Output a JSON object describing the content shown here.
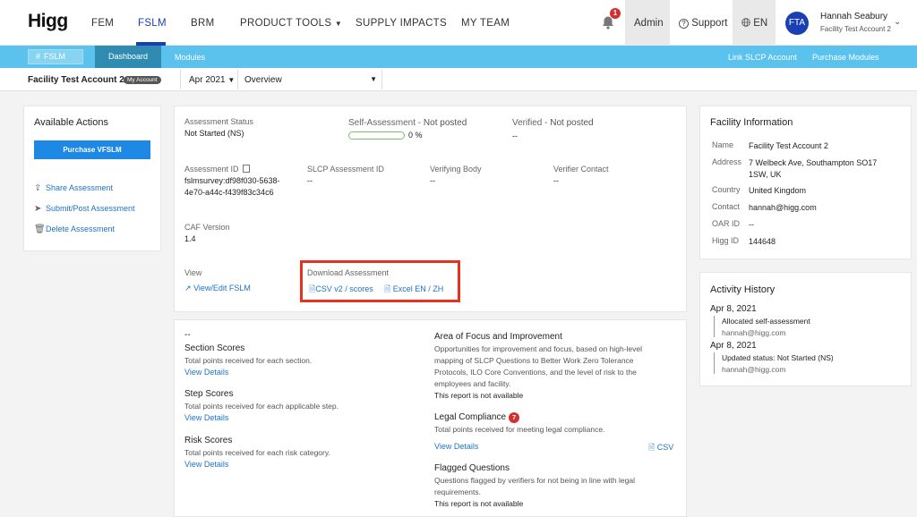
{
  "brand": {
    "logo": "Higg",
    "accent": "#1a3fb5",
    "subnav_color": "#5bc2ee"
  },
  "nav": {
    "items": [
      "FEM",
      "FSLM",
      "BRM",
      "PRODUCT TOOLS",
      "SUPPLY IMPACTS",
      "MY TEAM"
    ],
    "active": "FSLM",
    "notification_count": "1",
    "admin": "Admin",
    "support": "Support",
    "language": "EN"
  },
  "user": {
    "initials": "FTA",
    "name": "Hannah Seabury",
    "account": "Facility Test Account 2"
  },
  "subnav": {
    "pill": "FSLM",
    "tab": "Dashboard",
    "modules": "Modules",
    "link_slcp": "Link SLCP Account",
    "purchase_modules": "Purchase Modules"
  },
  "account_bar": {
    "name": "Facility Test Account 2",
    "badge": "My Account",
    "period": "Apr 2021",
    "view": "Overview"
  },
  "actions": {
    "title": "Available Actions",
    "purchase": "Purchase VFSLM",
    "items": [
      "Share Assessment",
      "Submit/Post Assessment",
      "Delete Assessment"
    ]
  },
  "assessment": {
    "status_label": "Assessment Status",
    "status_value": "Not Started (NS)",
    "self_label": "Self-Assessment - ",
    "self_value": "Not posted",
    "progress_percent": 0,
    "progress_text": "0 %",
    "verified_label": "Verified - ",
    "verified_value": "Not posted",
    "verified_sub": "--",
    "id_label": "Assessment ID",
    "id_value_line1": "fslmsurvey:df98f030-5638-",
    "id_value_line2": "4e70-a44c-f439f83c34c6",
    "slcp_label": "SLCP Assessment ID",
    "slcp_value": "--",
    "verifying_label": "Verifying Body",
    "verifying_value": "--",
    "verifier_label": "Verifier Contact",
    "verifier_value": "--",
    "caf_label": "CAF Version",
    "caf_value": "1.4",
    "view_label": "View",
    "view_link": "View/Edit FSLM",
    "download_label": "Download Assessment",
    "download_csv": "CSV v2 / scores",
    "download_excel": "Excel EN / ZH"
  },
  "scores": {
    "dash": "--",
    "section_title": "Section Scores",
    "section_desc": "Total points received for each section.",
    "step_title": "Step Scores",
    "step_desc": "Total points received for each applicable step.",
    "risk_title": "Risk Scores",
    "risk_desc": "Total points received for each risk category.",
    "view_details": "View Details",
    "focus_title": "Area of Focus and Improvement",
    "focus_desc": [
      "Opportunities for improvement and focus, based on high-level",
      "mapping of SLCP Questions to Better Work Zero Tolerance",
      "Protocols, ILO Core Conventions, and the level of risk to the",
      "employees and facility."
    ],
    "not_available": "This report is not available",
    "legal_title": "Legal Compliance",
    "legal_count": "7",
    "legal_desc": "Total points received for meeting legal compliance.",
    "csv": "CSV",
    "flagged_title": "Flagged Questions",
    "flagged_desc": [
      "Questions flagged by verifiers for not being in line with legal",
      "requirements."
    ]
  },
  "facility": {
    "title": "Facility Information",
    "name_label": "Name",
    "name_value": "Facility Test Account 2",
    "address_label": "Address",
    "address_line1": "7 Welbeck Ave, Southampton SO17",
    "address_line2": "1SW, UK",
    "country_label": "Country",
    "country_value": "United Kingdom",
    "contact_label": "Contact",
    "contact_value": "hannah@higg.com",
    "oar_label": "OAR ID",
    "oar_value": "--",
    "higg_label": "Higg ID",
    "higg_value": "144648"
  },
  "activity": {
    "title": "Activity History",
    "entries": [
      {
        "date": "Apr 8, 2021",
        "text": "Allocated self-assessment",
        "by": "hannah@higg.com"
      },
      {
        "date": "Apr 8, 2021",
        "text": "Updated status: Not Started (NS)",
        "by": "hannah@higg.com"
      }
    ]
  }
}
